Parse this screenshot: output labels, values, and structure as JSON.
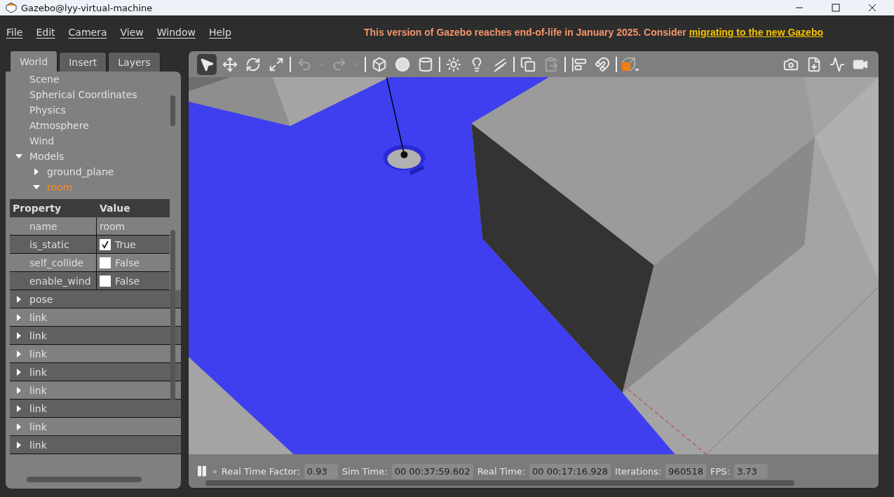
{
  "window": {
    "title": "Gazebo@lyy-virtual-machine"
  },
  "menu": [
    "File",
    "Edit",
    "Camera",
    "View",
    "Window",
    "Help"
  ],
  "notice": {
    "text": "This version of Gazebo reaches end-of-life in January 2025. Consider ",
    "link": "migrating to the new Gazebo"
  },
  "tabs": [
    {
      "label": "World",
      "selected": true
    },
    {
      "label": "Insert",
      "selected": false
    },
    {
      "label": "Layers",
      "selected": false
    }
  ],
  "tree": [
    {
      "label": "Scene"
    },
    {
      "label": "Spherical Coordinates"
    },
    {
      "label": "Physics"
    },
    {
      "label": "Atmosphere"
    },
    {
      "label": "Wind"
    },
    {
      "label": "Models",
      "expanded": true,
      "children": [
        {
          "label": "ground_plane",
          "expanded": false,
          "selected": false
        },
        {
          "label": "room",
          "expanded": true,
          "selected": true
        }
      ]
    }
  ],
  "properties": {
    "columns": [
      "Property",
      "Value"
    ],
    "rows": [
      {
        "kind": "text",
        "name": "name",
        "value": "room"
      },
      {
        "kind": "checkbox",
        "name": "is_static",
        "checked": true,
        "value": "True"
      },
      {
        "kind": "checkbox",
        "name": "self_collide",
        "checked": false,
        "value": "False"
      },
      {
        "kind": "checkbox",
        "name": "enable_wind",
        "checked": false,
        "value": "False"
      },
      {
        "kind": "group",
        "name": "pose",
        "expanded": false
      },
      {
        "kind": "group",
        "name": "link",
        "expanded": false
      },
      {
        "kind": "group",
        "name": "link",
        "expanded": false
      },
      {
        "kind": "group",
        "name": "link",
        "expanded": false
      },
      {
        "kind": "group",
        "name": "link",
        "expanded": false
      },
      {
        "kind": "group",
        "name": "link",
        "expanded": false
      },
      {
        "kind": "group",
        "name": "link",
        "expanded": false
      },
      {
        "kind": "group",
        "name": "link",
        "expanded": false
      },
      {
        "kind": "group",
        "name": "link",
        "expanded": false
      }
    ]
  },
  "toolbar": [
    {
      "kind": "select",
      "selected": true
    },
    {
      "kind": "translate",
      "selected": false
    },
    {
      "kind": "rotate",
      "selected": false
    },
    {
      "kind": "scale",
      "selected": false
    },
    {
      "kind": "sep"
    },
    {
      "kind": "undo",
      "disabled": true
    },
    {
      "kind": "redo",
      "disabled": true
    },
    {
      "kind": "sep"
    },
    {
      "kind": "box"
    },
    {
      "kind": "sphere"
    },
    {
      "kind": "cylinder"
    },
    {
      "kind": "sep"
    },
    {
      "kind": "pointlight"
    },
    {
      "kind": "spotlight"
    },
    {
      "kind": "dirlight"
    },
    {
      "kind": "sep"
    },
    {
      "kind": "copy",
      "disabled": false
    },
    {
      "kind": "paste",
      "disabled": true
    },
    {
      "kind": "sep"
    },
    {
      "kind": "align"
    },
    {
      "kind": "snap"
    },
    {
      "kind": "sep"
    },
    {
      "kind": "view"
    },
    {
      "kind": "spacer"
    },
    {
      "kind": "screenshot"
    },
    {
      "kind": "log"
    },
    {
      "kind": "plot"
    },
    {
      "kind": "record"
    }
  ],
  "status": {
    "step": "»",
    "fields": [
      {
        "label": "Real Time Factor:",
        "value": "0.93"
      },
      {
        "label": "Sim Time:",
        "value": "00 00:37:59.602"
      },
      {
        "label": "Real Time:",
        "value": "00 00:17:16.928"
      },
      {
        "label": "Iterations:",
        "value": "960518"
      },
      {
        "label": "FPS:",
        "value": "3.73"
      }
    ]
  }
}
